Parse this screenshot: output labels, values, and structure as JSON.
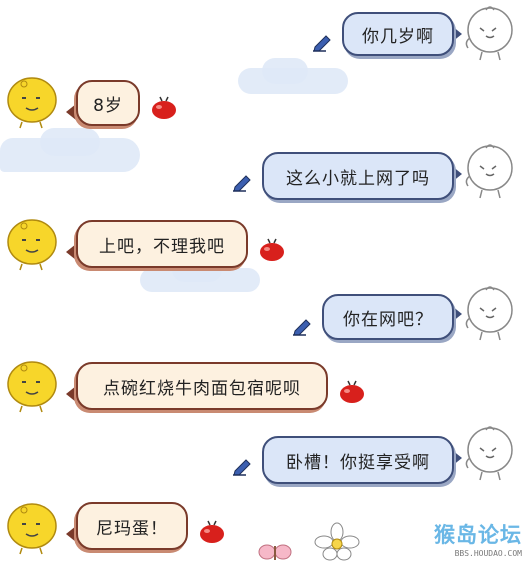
{
  "conversation": [
    {
      "sender": "me",
      "text": "你几岁啊"
    },
    {
      "sender": "bot",
      "text": "8岁"
    },
    {
      "sender": "me",
      "text": "这么小就上网了吗"
    },
    {
      "sender": "bot",
      "text": "上吧，不理我吧"
    },
    {
      "sender": "me",
      "text": "你在网吧？"
    },
    {
      "sender": "bot",
      "text": "点碗红烧牛肉面包宿呢呗"
    },
    {
      "sender": "me",
      "text": "卧槽！你挺享受啊"
    },
    {
      "sender": "bot",
      "text": "尼玛蛋！"
    }
  ],
  "colors": {
    "me_bubble_bg": "#dbe6f8",
    "me_bubble_border": "#3f4f7a",
    "bot_bubble_bg": "#fdf1e0",
    "bot_bubble_border": "#7a3a2a",
    "bot_avatar": "#f7d62a",
    "apple": "#d8201c"
  },
  "icons": {
    "me_avatar": "grey-chick-avatar-icon",
    "bot_avatar": "yellow-chick-avatar-icon",
    "send_marker": "pencil-icon",
    "reply_marker": "red-apple-icon"
  },
  "watermark": {
    "logo": "猴岛论坛",
    "url": "BBS.HOUDAO.COM"
  }
}
